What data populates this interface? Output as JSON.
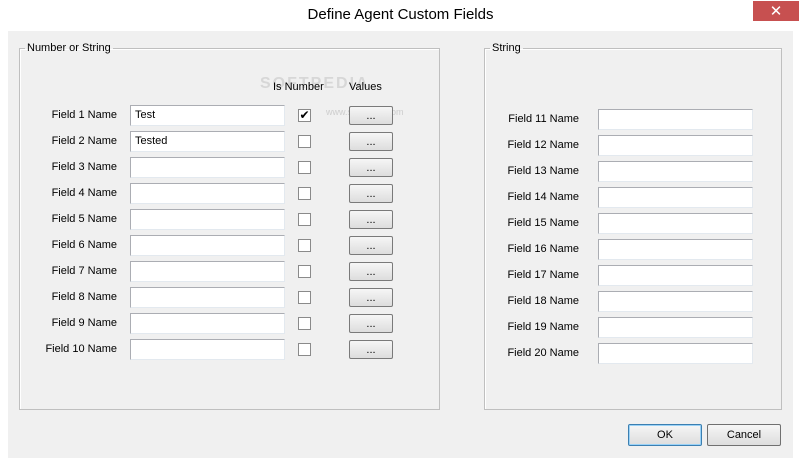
{
  "window": {
    "title": "Define Agent Custom Fields",
    "close_glyph": "✕"
  },
  "watermark": {
    "big": "SOFTPEDIA",
    "small": "www.softpedia.com"
  },
  "left_group": {
    "legend": "Number or String",
    "col_is_number": "Is Number",
    "col_values": "Values",
    "values_button_label": "...",
    "rows": [
      {
        "label": "Field 1 Name",
        "value": "Test",
        "is_number": true
      },
      {
        "label": "Field 2 Name",
        "value": "Tested",
        "is_number": false
      },
      {
        "label": "Field 3 Name",
        "value": "",
        "is_number": false
      },
      {
        "label": "Field 4 Name",
        "value": "",
        "is_number": false
      },
      {
        "label": "Field 5 Name",
        "value": "",
        "is_number": false
      },
      {
        "label": "Field 6 Name",
        "value": "",
        "is_number": false
      },
      {
        "label": "Field 7 Name",
        "value": "",
        "is_number": false
      },
      {
        "label": "Field 8 Name",
        "value": "",
        "is_number": false
      },
      {
        "label": "Field 9 Name",
        "value": "",
        "is_number": false
      },
      {
        "label": "Field 10 Name",
        "value": "",
        "is_number": false
      }
    ]
  },
  "right_group": {
    "legend": "String",
    "rows": [
      {
        "label": "Field 11 Name",
        "value": ""
      },
      {
        "label": "Field 12 Name",
        "value": ""
      },
      {
        "label": "Field 13 Name",
        "value": ""
      },
      {
        "label": "Field 14 Name",
        "value": ""
      },
      {
        "label": "Field 15 Name",
        "value": ""
      },
      {
        "label": "Field 16 Name",
        "value": ""
      },
      {
        "label": "Field 17 Name",
        "value": ""
      },
      {
        "label": "Field 18 Name",
        "value": ""
      },
      {
        "label": "Field 19 Name",
        "value": ""
      },
      {
        "label": "Field 20 Name",
        "value": ""
      }
    ]
  },
  "buttons": {
    "ok": "OK",
    "cancel": "Cancel"
  },
  "colors": {
    "dialog_bg": "#f0f0f0",
    "close_button": "#c75050",
    "frame": "#ffffff"
  }
}
